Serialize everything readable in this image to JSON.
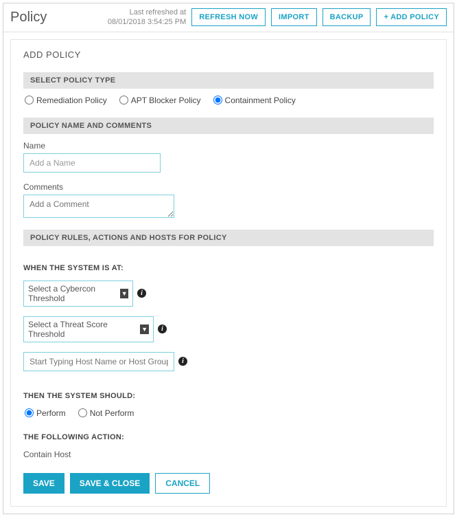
{
  "header": {
    "title": "Policy",
    "refreshed_label": "Last refreshed at",
    "refreshed_time": "08/01/2018 3:54:25 PM",
    "btn_refresh": "REFRESH NOW",
    "btn_import": "IMPORT",
    "btn_backup": "BACKUP",
    "btn_add": "+ ADD POLICY"
  },
  "form": {
    "title": "ADD POLICY",
    "sections": {
      "type": {
        "bar": "SELECT POLICY TYPE",
        "options": [
          {
            "label": "Remediation Policy",
            "checked": false
          },
          {
            "label": "APT Blocker Policy",
            "checked": false
          },
          {
            "label": "Containment Policy",
            "checked": true
          }
        ]
      },
      "name": {
        "bar": "POLICY NAME AND COMMENTS",
        "name_label": "Name",
        "name_placeholder": "Add a Name",
        "comments_label": "Comments",
        "comments_placeholder": "Add a Comment"
      },
      "rules": {
        "bar": "POLICY RULES, ACTIONS AND HOSTS FOR POLICY",
        "when_label": "WHEN THE SYSTEM IS AT:",
        "cybercon_select": "Select a Cybercon Threshold",
        "threat_select": "Select a Threat Score Threshold",
        "host_placeholder": "Start Typing Host Name or Host Group",
        "then_label": "THEN THE SYSTEM SHOULD:",
        "perform_options": [
          {
            "label": "Perform",
            "checked": true
          },
          {
            "label": "Not Perform",
            "checked": false
          }
        ],
        "action_label": "THE FOLLOWING ACTION:",
        "action_value": "Contain Host"
      }
    },
    "buttons": {
      "save": "SAVE",
      "save_close": "SAVE & CLOSE",
      "cancel": "CANCEL"
    }
  }
}
